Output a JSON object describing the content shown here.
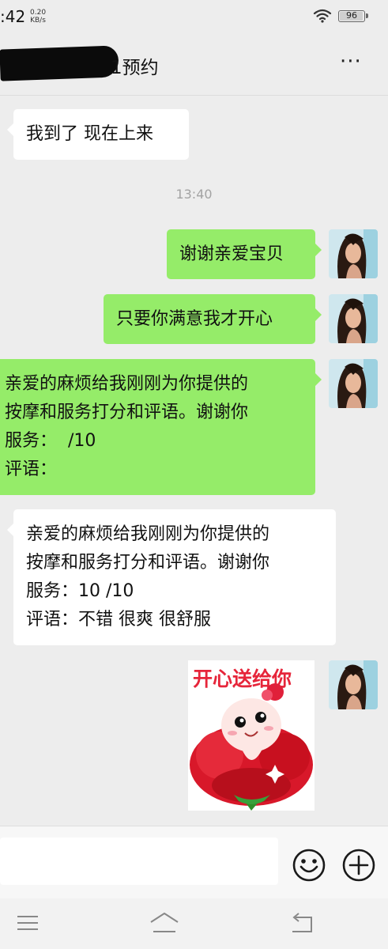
{
  "status": {
    "time": ":42",
    "speed_value": "0.20",
    "speed_unit": "KB/s",
    "battery": "96"
  },
  "header": {
    "title": "1预约",
    "more_label": "···"
  },
  "messages": [
    {
      "side": "left",
      "text": "我到了 现在上来"
    },
    {
      "side": "right",
      "text": "谢谢亲爱宝贝"
    },
    {
      "side": "right",
      "text": "只要你满意我才开心"
    },
    {
      "side": "right",
      "text": "亲爱的麻烦给我刚刚为你提供的\n按摩和服务打分和评语。谢谢你\n服务：  /10\n评语："
    },
    {
      "side": "left",
      "text": "亲爱的麻烦给我刚刚为你提供的\n按摩和服务打分和评语。谢谢你\n服务：10 /10\n评语：不错 很爽 很舒服"
    }
  ],
  "timestamp": "13:40",
  "sticker": {
    "caption": "开心送给你"
  },
  "colors": {
    "background": "#ededed",
    "bubble_sent": "#95ec69",
    "bubble_received": "#ffffff"
  },
  "icons": {
    "wifi": "wifi-icon",
    "battery": "battery-icon",
    "more": "more-icon",
    "emoji": "emoji-icon",
    "plus": "plus-icon",
    "menu": "menu-icon",
    "home": "home-icon",
    "back": "back-icon"
  }
}
